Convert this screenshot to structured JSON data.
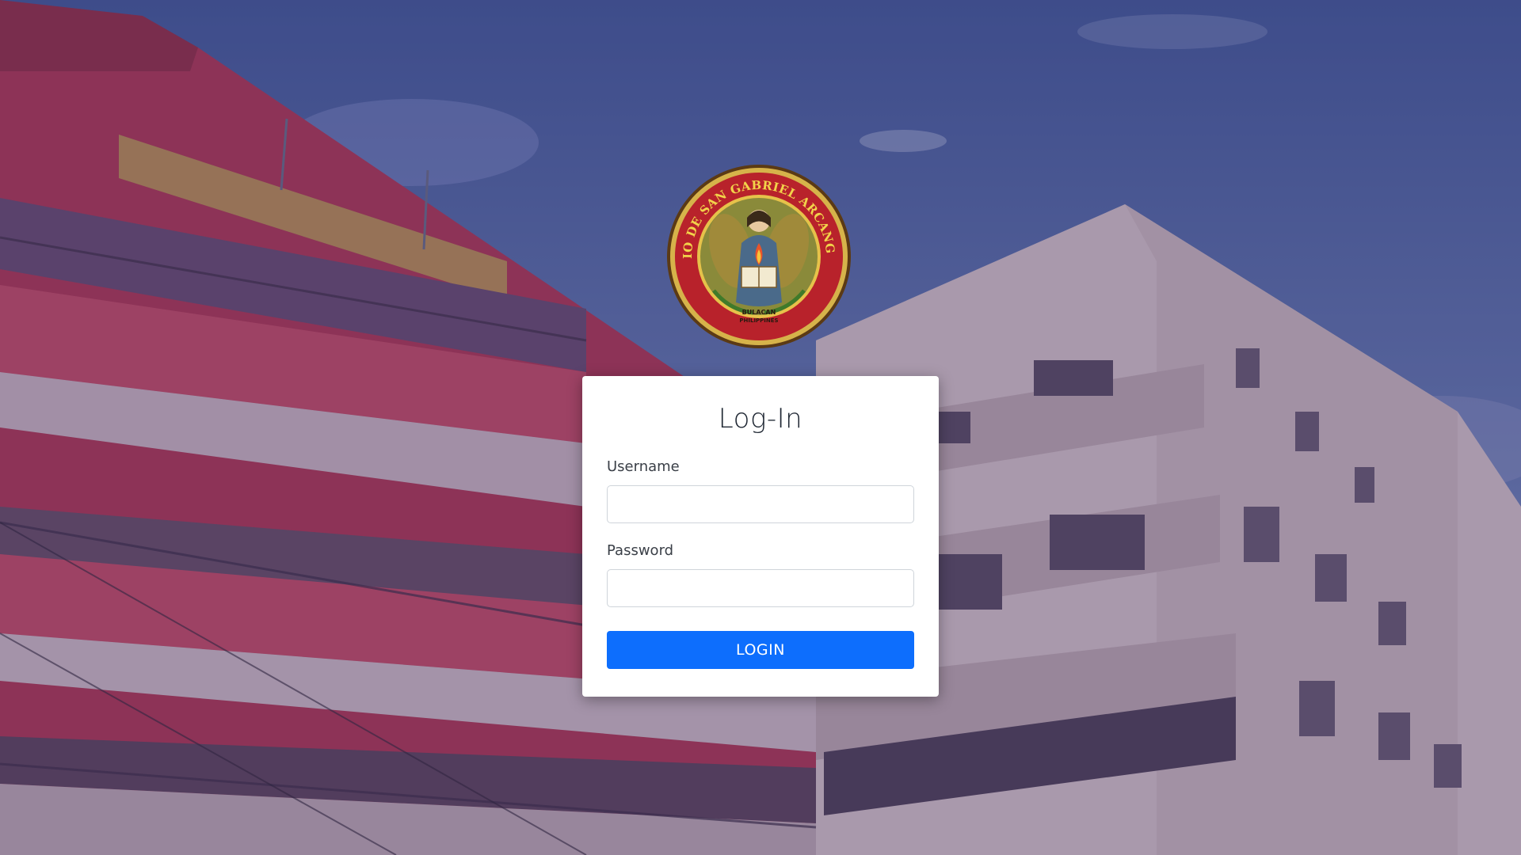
{
  "background": {
    "overlay_color": "#3c3470",
    "sky_color": "#4f6aa3",
    "building_red": "#c9344a",
    "building_white": "#e6d3cf"
  },
  "logo": {
    "arc_text": "COLEGIO DE SAN GABRIEL ARCANGEL INC.",
    "lower_text_1": "BULACAN",
    "lower_text_2": "PHILIPPINES",
    "ring_color": "#b8222b",
    "gold_color": "#e6c24a"
  },
  "login": {
    "title": "Log-In",
    "username_label": "Username",
    "username_value": "",
    "password_label": "Password",
    "password_value": "",
    "button_label": "LOGIN",
    "button_color": "#0d6efd"
  }
}
